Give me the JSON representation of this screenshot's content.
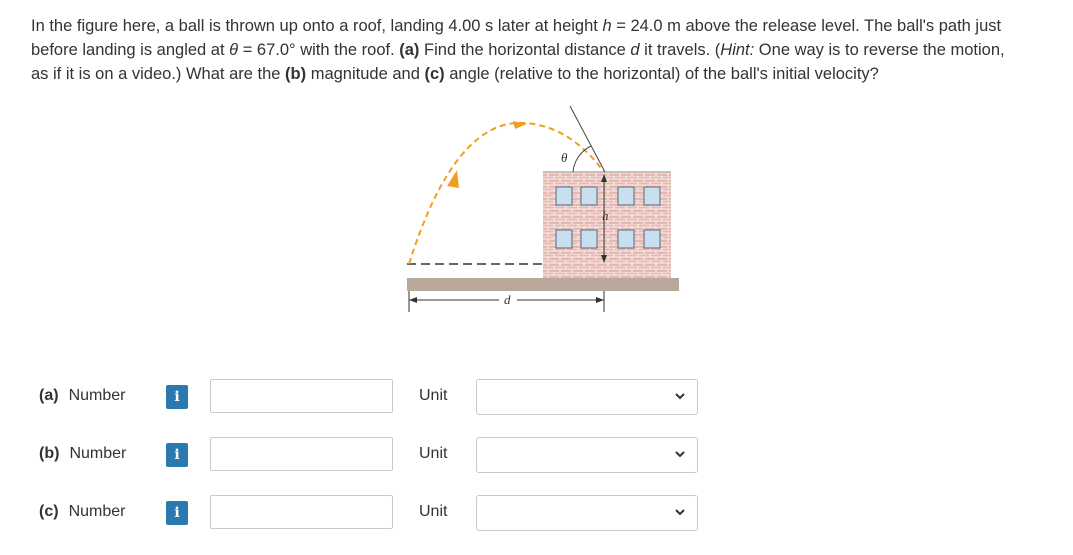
{
  "question": {
    "line1_a": "In the figure here, a ball is thrown up onto a roof, landing 4.00 s later at height ",
    "h_var": "h",
    "line1_b": " = 24.0 m above the release level. The ball's path just",
    "line2_a": "before landing is angled at ",
    "theta_var": "θ",
    "line2_b": " = 67.0° with the roof. ",
    "part_a": "(a)",
    "line2_c": " Find the horizontal distance ",
    "d_var": "d",
    "line2_d": " it travels. (",
    "hint": "Hint:",
    "line2_e": " One way is to reverse the motion,",
    "line3_a": "as if it is on a video.) What are the ",
    "part_b": "(b)",
    "line3_b": " magnitude and ",
    "part_c": "(c)",
    "line3_c": " angle (relative to the horizontal) of the ball's initial velocity?"
  },
  "figure": {
    "theta_label": "θ",
    "h_label": "h",
    "d_label": "d",
    "colors": {
      "ground": "#b8a89a",
      "brick": "#e8b8b0",
      "window": "#c9dff0",
      "path": "#f0a020"
    }
  },
  "answers": [
    {
      "part": "(a)",
      "label": "Number",
      "info": "i",
      "value": "",
      "unit_label": "Unit",
      "unit_value": ""
    },
    {
      "part": "(b)",
      "label": "Number",
      "info": "i",
      "value": "",
      "unit_label": "Unit",
      "unit_value": ""
    },
    {
      "part": "(c)",
      "label": "Number",
      "info": "i",
      "value": "",
      "unit_label": "Unit",
      "unit_value": ""
    }
  ]
}
